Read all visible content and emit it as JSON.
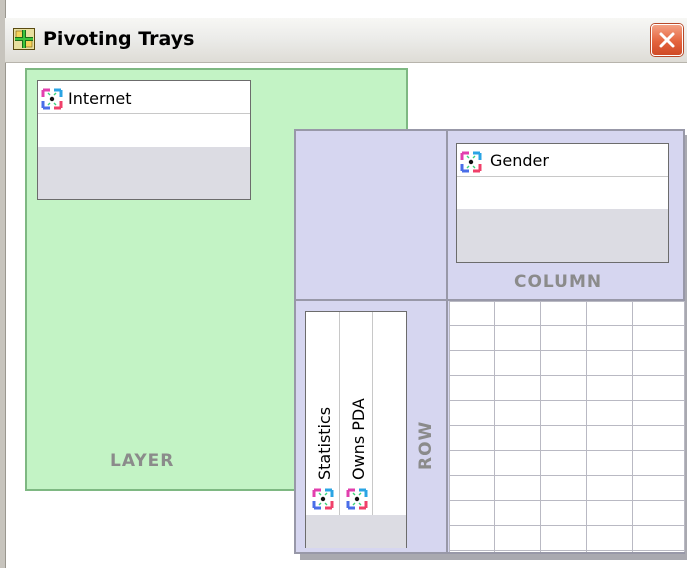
{
  "window": {
    "title": "Pivoting Trays",
    "close_icon": "close-icon",
    "app_icon": "pivot-tray-icon"
  },
  "layer": {
    "label": "LAYER",
    "variables": [
      {
        "label": "Internet",
        "icon": "variable-icon"
      }
    ]
  },
  "column": {
    "label": "COLUMN",
    "variables": [
      {
        "label": "Gender",
        "icon": "variable-icon"
      }
    ]
  },
  "row": {
    "label": "ROW",
    "variables": [
      {
        "label": "Statistics",
        "icon": "variable-icon"
      },
      {
        "label": "Owns PDA",
        "icon": "variable-icon"
      }
    ]
  },
  "colors": {
    "layer_bg": "#c3f3c5",
    "pivot_bg": "#d6d6f0",
    "close_btn": "#e4643e"
  }
}
